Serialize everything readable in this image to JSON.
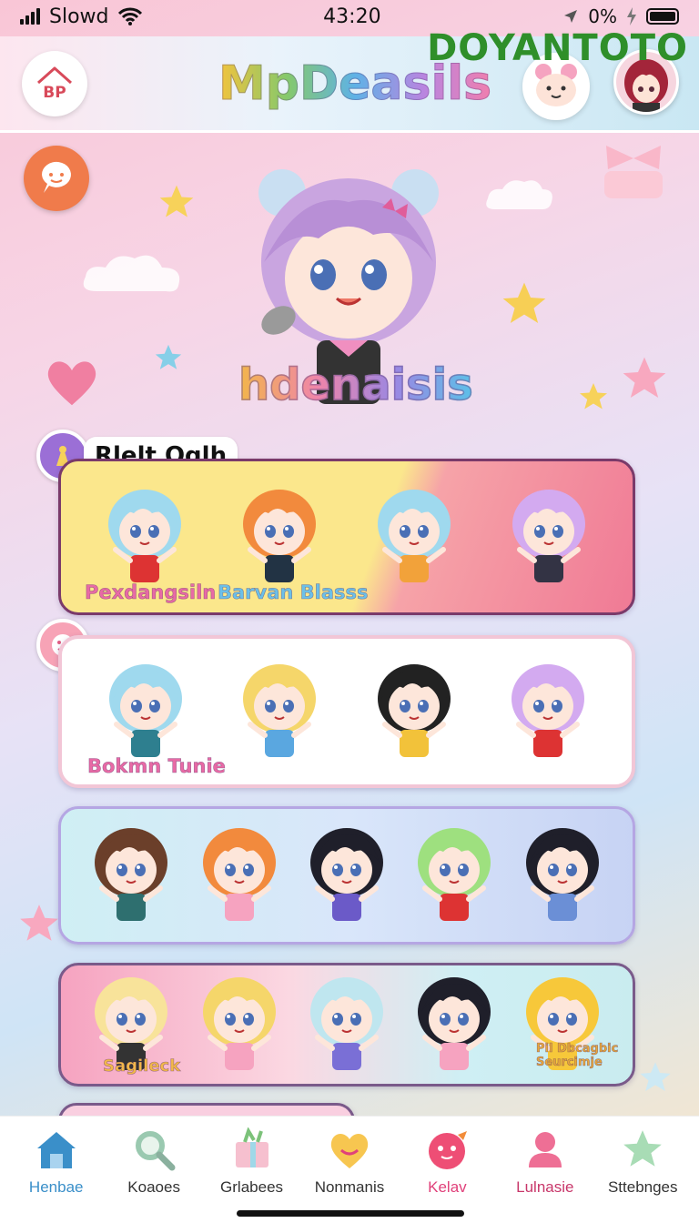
{
  "status_bar": {
    "carrier": "Slowd",
    "time": "43:20",
    "battery_text": "0%"
  },
  "header": {
    "app_title": "MpDeasils",
    "watermark": "DOYANTOTO",
    "logo_text": "BP"
  },
  "hero": {
    "title": "hdenaisis"
  },
  "sections": [
    {
      "badge_label": "Rlelt Oglh",
      "card_labels": [
        "Pexdangsiln",
        "Barvan Blasss"
      ]
    },
    {
      "badge_label": "",
      "card_labels": [
        "Bokmn Tunie"
      ]
    },
    {
      "badge_label": "",
      "card_labels": []
    },
    {
      "badge_label": "",
      "card_labels": [
        "Sagileck",
        "Pil Dbcagbic Seurcimje"
      ]
    }
  ],
  "nav": [
    {
      "label": "Henbae",
      "icon": "home-icon",
      "active": true
    },
    {
      "label": "Koaoes",
      "icon": "search-icon",
      "active": false
    },
    {
      "label": "Grlabees",
      "icon": "gift-icon",
      "active": false
    },
    {
      "label": "Nonmanis",
      "icon": "heart-face-icon",
      "active": false
    },
    {
      "label": "Kelav",
      "icon": "mascot-icon",
      "active": false
    },
    {
      "label": "Lulnasie",
      "icon": "profile-icon",
      "active": false
    },
    {
      "label": "Sttebnges",
      "icon": "star-settings-icon",
      "active": false
    }
  ],
  "colors": {
    "accent_pink": "#f07fae",
    "nav_active": "#3a8fc9",
    "nav_pink": "#e0407a"
  }
}
